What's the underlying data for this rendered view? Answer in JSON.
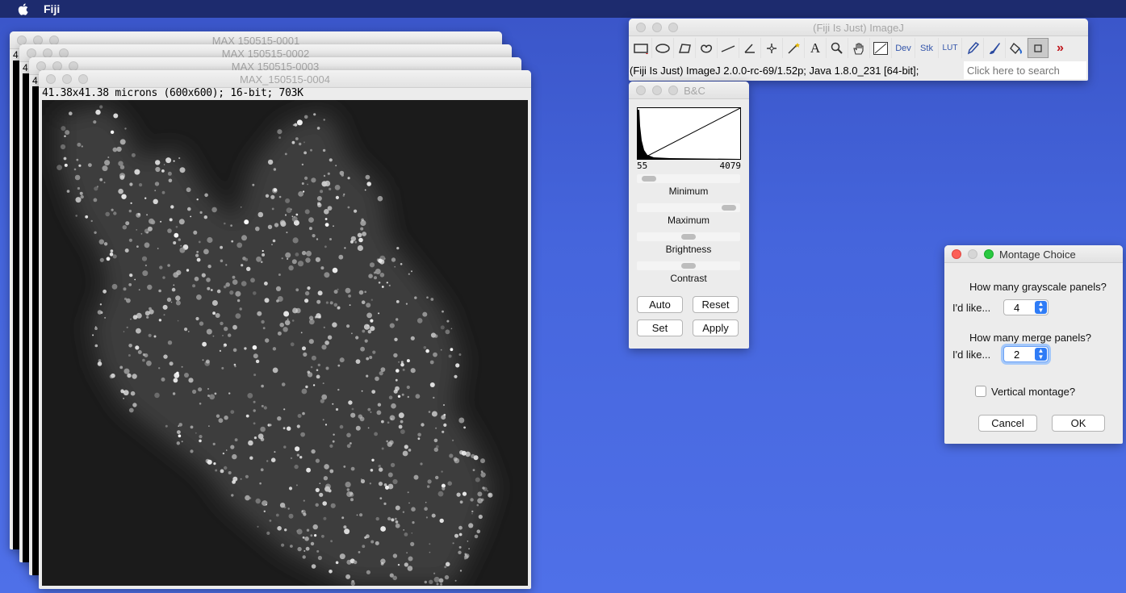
{
  "menubar": {
    "app_name": "Fiji"
  },
  "image_windows": [
    {
      "title": "MAX 150515-0001",
      "partial_label": "4"
    },
    {
      "title": "MAX 150515-0002",
      "partial_label": "4"
    },
    {
      "title": "MAX 150515-0003",
      "partial_label": "4"
    },
    {
      "title": "MAX_150515-0004",
      "info": "41.38x41.38 microns (600x600); 16-bit; 703K"
    }
  ],
  "imagej": {
    "title": "(Fiji Is Just) ImageJ",
    "tools": [
      "rectangle-tool",
      "oval-tool",
      "polygon-tool",
      "freehand-tool",
      "line-tool",
      "angle-tool",
      "point-tool",
      "wand-tool",
      "text-tool",
      "magnifier-tool",
      "hand-tool",
      "color-picker-tool",
      "dev-menu",
      "stacks-menu",
      "lut-menu",
      "pencil-tool",
      "brush-tool",
      "flood-fill-tool",
      "selected-tool",
      "more-tools"
    ],
    "dev_label": "Dev",
    "stk_label": "Stk",
    "lut_label": "LUT",
    "status": "(Fiji Is Just) ImageJ 2.0.0-rc-69/1.52p; Java 1.8.0_231 [64-bit];",
    "search_placeholder": "Click here to search"
  },
  "bc": {
    "title": "B&C",
    "hist_min": "55",
    "hist_max": "4079",
    "minimum_label": "Minimum",
    "maximum_label": "Maximum",
    "brightness_label": "Brightness",
    "contrast_label": "Contrast",
    "minimum_pos": 0.05,
    "maximum_pos": 0.95,
    "brightness_pos": 0.5,
    "contrast_pos": 0.5,
    "auto": "Auto",
    "reset": "Reset",
    "set": "Set",
    "apply": "Apply"
  },
  "montage": {
    "title": "Montage Choice",
    "q1": "How many grayscale panels?",
    "like1": "I'd like...",
    "val1": "4",
    "q2": "How many merge panels?",
    "like2": "I'd like...",
    "val2": "2",
    "vertical": "Vertical montage?",
    "cancel": "Cancel",
    "ok": "OK"
  }
}
